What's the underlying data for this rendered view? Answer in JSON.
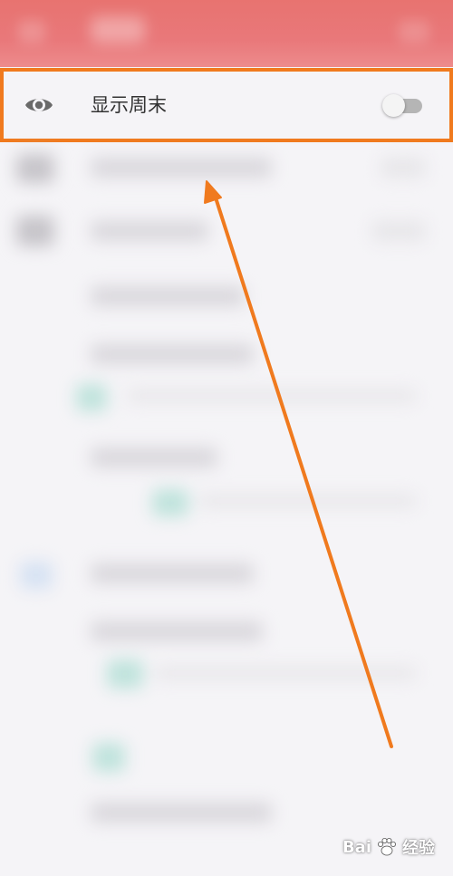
{
  "setting_row": {
    "label": "显示周末",
    "icon": "eye-icon",
    "toggle_on": false
  },
  "colors": {
    "toolbar": "#e87370",
    "highlight_border": "#f07a1e",
    "arrow": "#f07a1e",
    "toggle_track_off": "#b5b5b5"
  },
  "watermark": {
    "logo_text": "Bai",
    "suffix": "经验"
  }
}
